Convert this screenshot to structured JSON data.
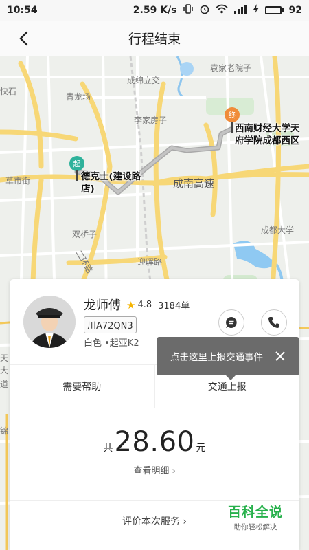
{
  "status_bar": {
    "time": "10:54",
    "network_speed": "2.59 K/s",
    "battery": "92",
    "battery_percent": 92
  },
  "header": {
    "title": "行程结束",
    "back_icon": "chevron-left-icon"
  },
  "map": {
    "labels": {
      "chengmian_flyover": "成绵立交",
      "qinglongchang": "青龙场",
      "yuanjia_laoyuanzi": "袁家老院子",
      "lijia_fangzi": "李家房子",
      "kuaishi": "快石",
      "caoshi_street": "草市街",
      "shuangqiaozi": "双桥子",
      "chengnan_expressway": "成南高速",
      "chengdu_university": "成都大学",
      "yinghui_road": "迎晖路",
      "second_ring": "二环路",
      "left_tian": "天",
      "left_da": "大",
      "left_dao": "道",
      "left_jin": "锦"
    },
    "start_pin": "起",
    "start_place": "德克士(建设路店)",
    "end_pin": "终",
    "end_place": "西南财经大学天府学院成都西区",
    "colors": {
      "start": "#2fb29b",
      "end": "#f08c3a",
      "route": "#b3b3b3"
    }
  },
  "driver": {
    "name": "龙师傅",
    "rating": "4.8",
    "orders": "3184单",
    "plate": "川A72QN3",
    "car": "白色 •起亚K2"
  },
  "tooltip": {
    "text": "点击这里上报交通事件"
  },
  "actions": {
    "help": "需要帮助",
    "report": "交通上报"
  },
  "fare": {
    "prefix": "共",
    "amount": "28.60",
    "unit": "元",
    "detail": "查看明细"
  },
  "rate": {
    "label": "评价本次服务"
  },
  "watermark": {
    "title": "百科全说",
    "subtitle": "助你轻松解决"
  }
}
